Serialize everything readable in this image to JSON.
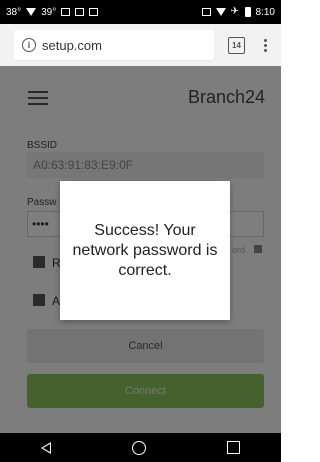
{
  "status_bar": {
    "left_text_1": "38°",
    "left_text_2": "39°",
    "time": "8:10"
  },
  "browser": {
    "url": "setup.com",
    "tab_count": "14"
  },
  "header": {
    "brand": "Branch24"
  },
  "form": {
    "bssid_label": "BSSID",
    "bssid_value": "A0:63:91:83:E9:0F",
    "password_label": "Passw",
    "password_value": "••••",
    "show_password_label": "ord",
    "checkbox1_label": "R",
    "checkbox2_label": "A",
    "cancel_label": "Cancel",
    "connect_label": "Connect"
  },
  "dialog": {
    "message": "Success! Your network password is correct."
  },
  "colors": {
    "accent": "#8bc25a"
  }
}
